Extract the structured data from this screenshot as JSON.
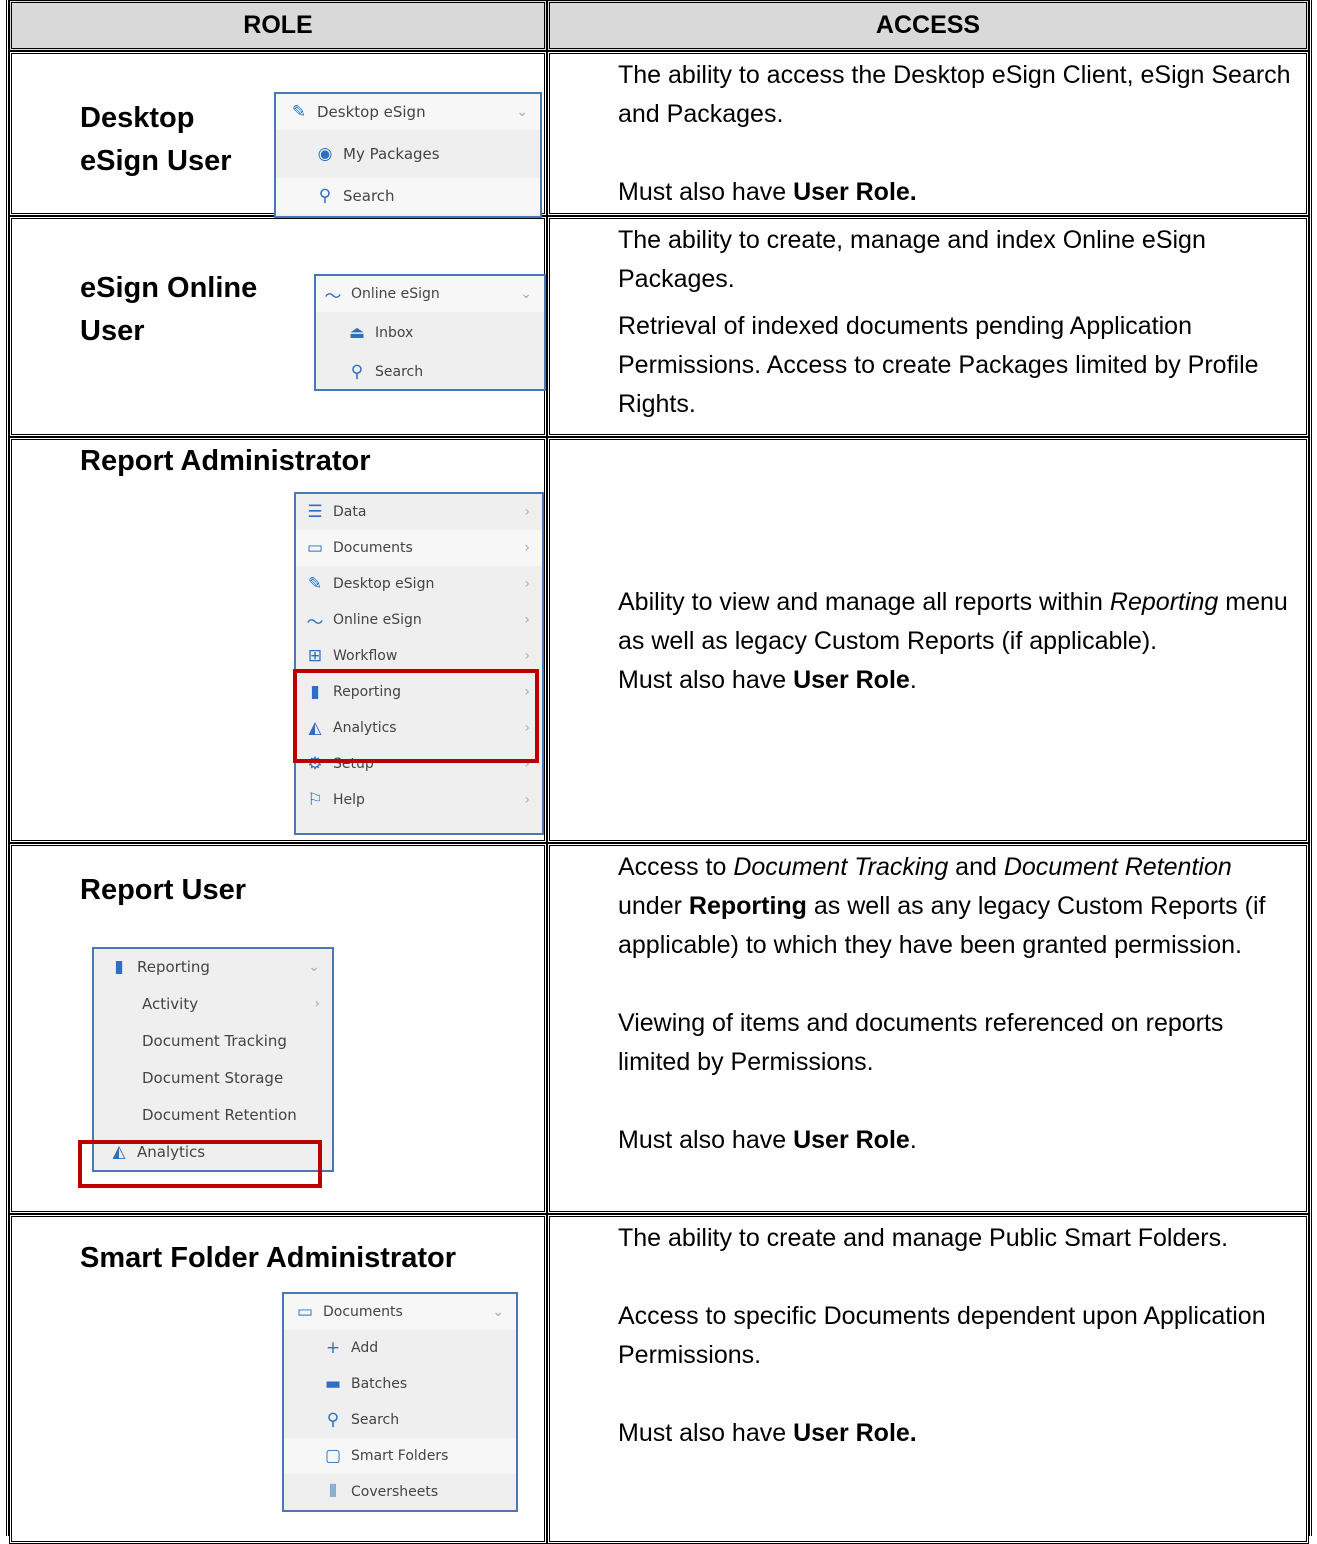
{
  "headers": {
    "role": "ROLE",
    "access": "ACCESS"
  },
  "rows": [
    {
      "role": [
        "Desktop",
        "eSign User"
      ],
      "menu": [
        {
          "icon": "pencil-icon",
          "glyph": "✎",
          "label": "Desktop eSign",
          "chevron": "⌄"
        },
        {
          "icon": "user-circle-icon",
          "glyph": "◉",
          "label": "My Packages"
        },
        {
          "icon": "search-icon",
          "glyph": "⚲",
          "label": "Search"
        }
      ],
      "access": {
        "p1": "The ability to access the Desktop eSign Client, eSign Search and Packages.",
        "must_prefix": "Must also have ",
        "must_bold": "User Role."
      }
    },
    {
      "role": [
        "eSign Online",
        "User"
      ],
      "menu": [
        {
          "icon": "signature-icon",
          "glyph": "〜",
          "label": "Online eSign",
          "chevron": "⌄"
        },
        {
          "icon": "inbox-icon",
          "glyph": "⏏",
          "label": "Inbox"
        },
        {
          "icon": "search-icon",
          "glyph": "⚲",
          "label": "Search"
        }
      ],
      "access": {
        "p1": "The ability to create, manage and index Online eSign Packages.",
        "p2": "Retrieval of indexed documents pending Application Permissions.  Access to create Packages limited by Profile Rights."
      }
    },
    {
      "role": [
        "Report Administrator"
      ],
      "menu": [
        {
          "icon": "database-icon",
          "glyph": "☰",
          "label": "Data"
        },
        {
          "icon": "clipboard-icon",
          "glyph": "▭",
          "label": "Documents"
        },
        {
          "icon": "pencil-icon",
          "glyph": "✎",
          "label": "Desktop eSign"
        },
        {
          "icon": "signature-icon",
          "glyph": "〜",
          "label": "Online eSign"
        },
        {
          "icon": "sitemap-icon",
          "glyph": "⊞",
          "label": "Workflow"
        },
        {
          "icon": "file-icon",
          "glyph": "▮",
          "label": "Reporting"
        },
        {
          "icon": "area-chart-icon",
          "glyph": "◭",
          "label": "Analytics"
        },
        {
          "icon": "gear-icon",
          "glyph": "⚙",
          "label": "Setup"
        },
        {
          "icon": "flag-icon",
          "glyph": "⚐",
          "label": "Help"
        }
      ],
      "chev": "›",
      "access": {
        "p1a": "Ability to view and manage all reports within ",
        "p1i": "Reporting",
        "p1b": " menu as well as legacy Custom Reports (if applicable).",
        "must_prefix": "Must also have ",
        "must_bold": "User Role",
        "must_suffix": "."
      }
    },
    {
      "role": [
        "Report User"
      ],
      "menu": [
        {
          "icon": "file-icon",
          "glyph": "▮",
          "label": "Reporting",
          "chevron": "⌄"
        },
        {
          "label": "Activity",
          "chevron": "›"
        },
        {
          "label": "Document Tracking"
        },
        {
          "label": "Document Storage"
        },
        {
          "label": "Document Retention"
        },
        {
          "icon": "area-chart-icon",
          "glyph": "◭",
          "label": "Analytics"
        }
      ],
      "access": {
        "a": "Access to ",
        "i1": "Document Tracking",
        "b": " and ",
        "i2": "Document Retention",
        "c": " under ",
        "bold": "Reporting",
        "d": " as well as any legacy Custom Reports (if applicable) to which they have been granted permission.",
        "p2": "Viewing of items and documents referenced on reports limited by Permissions.",
        "must_prefix": "Must also have ",
        "must_bold": "User Role",
        "must_suffix": "."
      }
    },
    {
      "role": [
        "Smart Folder Administrator"
      ],
      "menu": [
        {
          "icon": "clipboard-icon",
          "glyph": "▭",
          "label": "Documents",
          "chevron": "⌄"
        },
        {
          "icon": "plus-icon",
          "glyph": "+",
          "label": "Add"
        },
        {
          "icon": "archive-icon",
          "glyph": "▬",
          "label": "Batches"
        },
        {
          "icon": "search-icon",
          "glyph": "⚲",
          "label": "Search"
        },
        {
          "icon": "folder-icon",
          "glyph": "▢",
          "label": "Smart Folders"
        },
        {
          "icon": "barcode-icon",
          "glyph": "⦀",
          "label": "Coversheets"
        }
      ],
      "access": {
        "p1": "The ability to create and manage Public Smart Folders.",
        "p2": "Access to specific Documents dependent upon Application Permissions.",
        "must_prefix": "Must also have ",
        "must_bold": "User Role."
      }
    }
  ]
}
